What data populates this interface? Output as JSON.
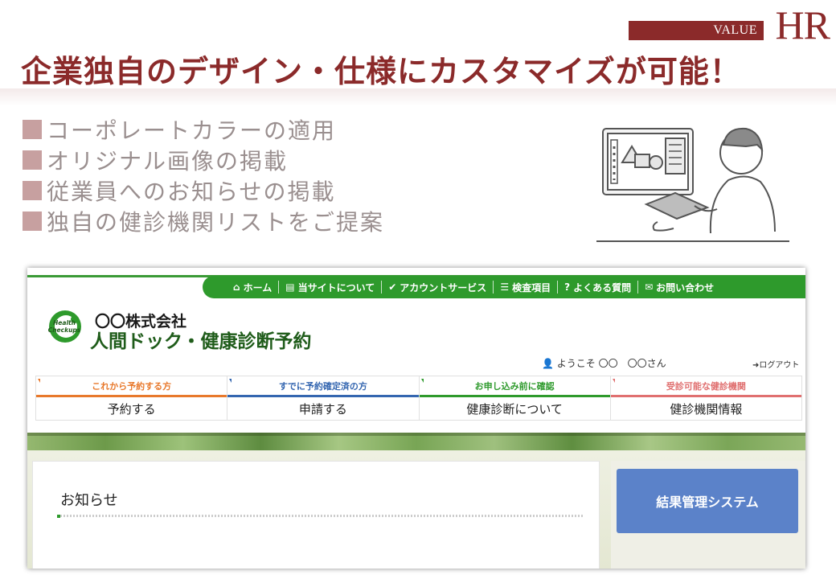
{
  "badge": {
    "value": "VALUE",
    "hr": "HR"
  },
  "headline": "企業独自のデザイン・仕様にカスタマイズが可能！",
  "features": [
    "コーポレートカラーの適用",
    "オリジナル画像の掲載",
    "従業員へのお知らせの掲載",
    "独自の健診機関リストをご提案"
  ],
  "colors": {
    "accent": "#8b2a2a",
    "site_green": "#2e9a2c",
    "button_blue": "#5b82c9"
  },
  "site": {
    "logo_text": [
      "Health",
      "Checkups"
    ],
    "company": "〇〇株式会社",
    "service_name": "人間ドック・健康診断予約",
    "topnav": [
      {
        "icon": "home-icon",
        "label": "ホーム"
      },
      {
        "icon": "book-icon",
        "label": "当サイトについて"
      },
      {
        "icon": "check-circle-icon",
        "label": "アカウントサービス"
      },
      {
        "icon": "list-icon",
        "label": "検査項目"
      },
      {
        "icon": "question-icon",
        "label": "よくある質問"
      },
      {
        "icon": "mail-icon",
        "label": "お問い合わせ"
      }
    ],
    "welcome": {
      "prefix": "ようこそ",
      "name": "〇〇　〇〇さん"
    },
    "logout": "ログアウト",
    "tabs": [
      {
        "caption": "これから予約する方",
        "label": "予約する",
        "color": "#e8792c"
      },
      {
        "caption": "すでに予約確定済の方",
        "label": "申請する",
        "color": "#3466b0"
      },
      {
        "caption": "お申し込み前に確認",
        "label": "健康診断について",
        "color": "#2e9a2c"
      },
      {
        "caption": "受診可能な健診機関",
        "label": "健診機関情報",
        "color": "#e07070"
      }
    ],
    "notice_title": "お知らせ",
    "result_button": "結果管理システム"
  }
}
